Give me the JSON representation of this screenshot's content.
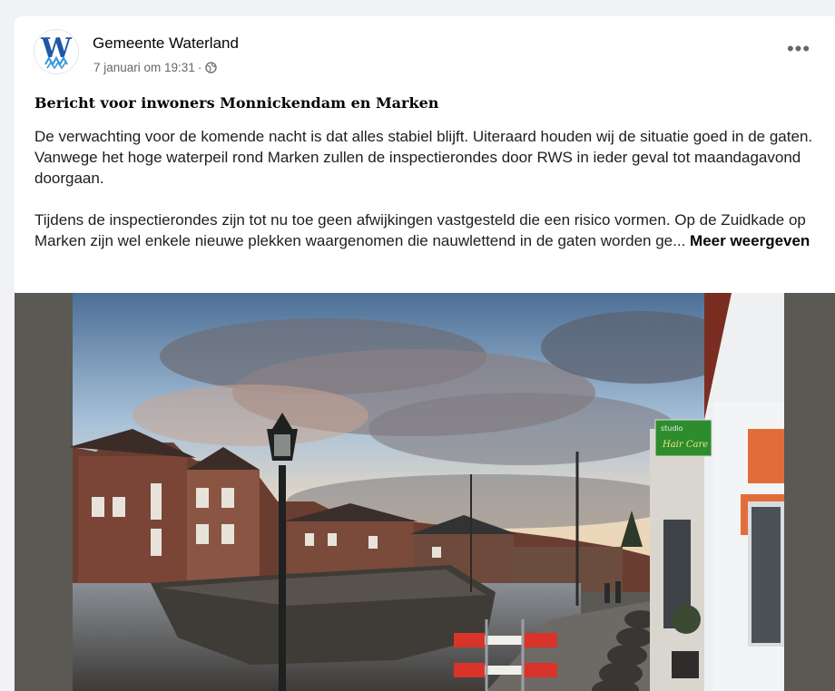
{
  "post": {
    "author": "Gemeente Waterland",
    "date": "7 januari om 19:31",
    "separator": "·",
    "privacy_icon": "globe-icon",
    "more_label": "•••",
    "title": "Bericht voor inwoners Monnickendam en Marken",
    "paragraph1": "De verwachting voor de komende nacht is dat alles stabiel blijft. Uiteraard houden wij de situatie goed in de gaten. Vanwege het hoge waterpeil rond Marken zullen de inspectierondes door RWS in ieder geval tot maandagavond doorgaan.",
    "paragraph2": "Tijdens de inspectierondes zijn tot nu toe geen afwijkingen vastgesteld die een risico vormen. Op de Zuidkade op Marken zijn wel enkele nieuwe plekken waargenomen die nauwlettend in de gaten worden ge...",
    "see_more": "Meer weergeven",
    "logo_letter": "W"
  },
  "photo": {
    "sign_top": "studio",
    "sign_bottom": "Hair Care"
  },
  "colors": {
    "logo_blue": "#1f57a8",
    "text": "#1c1e21",
    "muted": "#65676b",
    "background": "#f0f2f5"
  }
}
